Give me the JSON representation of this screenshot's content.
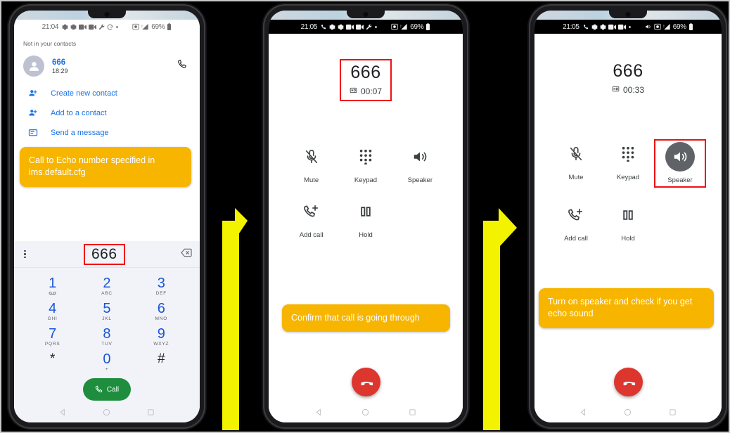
{
  "meta": {
    "accent_yellow": "#F7B500",
    "arrow_yellow": "#F3F300",
    "highlight_red": "#EE1111",
    "link_blue": "#1A73E8",
    "call_green": "#1E8E3E",
    "end_red": "#DC362E"
  },
  "phone1": {
    "statusbar": {
      "time": "21:04",
      "battery": "69%",
      "icons": [
        "gear-icon",
        "gear-icon",
        "video-icon",
        "video-icon",
        "wrench-icon",
        "google-g-icon",
        "dot-icon"
      ],
      "right_icons": [
        "screenshot-icon",
        "signal-icon",
        "battery-icon"
      ]
    },
    "not_in_contacts": "Not in your contacts",
    "contact": {
      "number": "666",
      "time": "18:29",
      "call_icon": "phone-icon",
      "avatar": "avatar-icon"
    },
    "actions": [
      {
        "label": "Create new contact",
        "icon": "add-person-icon"
      },
      {
        "label": "Add to a contact",
        "icon": "add-person-icon"
      },
      {
        "label": "Send a message",
        "icon": "message-icon"
      }
    ],
    "dialer": {
      "entered_number": "666",
      "menu_icon": "kebab-menu-icon",
      "backspace_icon": "backspace-icon",
      "keys": [
        {
          "digit": "1",
          "letters": ""
        },
        {
          "digit": "2",
          "letters": "ABC"
        },
        {
          "digit": "3",
          "letters": "DEF"
        },
        {
          "digit": "4",
          "letters": "GHI"
        },
        {
          "digit": "5",
          "letters": "JKL"
        },
        {
          "digit": "6",
          "letters": "MNO"
        },
        {
          "digit": "7",
          "letters": "PQRS"
        },
        {
          "digit": "8",
          "letters": "TUV"
        },
        {
          "digit": "9",
          "letters": "WXYZ"
        },
        {
          "digit": "*",
          "letters": ""
        },
        {
          "digit": "0",
          "letters": "+"
        },
        {
          "digit": "#",
          "letters": ""
        }
      ],
      "call_label": "Call"
    },
    "callout": "Call to Echo number specified in ims.default.cfg"
  },
  "phone2": {
    "statusbar": {
      "time": "21:05",
      "battery": "69%",
      "icons": [
        "phone-active-icon",
        "gear-icon",
        "gear-icon",
        "video-icon",
        "video-icon",
        "wrench-icon",
        "dot-icon"
      ],
      "right_icons": [
        "screenshot-icon",
        "signal-icon",
        "battery-icon"
      ]
    },
    "call": {
      "name": "666",
      "timer": "00:07",
      "hd_icon": "hd-call-icon"
    },
    "controls": [
      {
        "label": "Mute",
        "icon": "mic-off-icon",
        "active": false
      },
      {
        "label": "Keypad",
        "icon": "dialpad-icon",
        "active": false
      },
      {
        "label": "Speaker",
        "icon": "speaker-icon",
        "active": false
      },
      {
        "label": "Add call",
        "icon": "add-call-icon",
        "active": false
      },
      {
        "label": "Hold",
        "icon": "pause-icon",
        "active": false
      }
    ],
    "end_call_icon": "end-call-icon",
    "callout": "Confirm that call is going through"
  },
  "phone3": {
    "statusbar": {
      "time": "21:05",
      "battery": "69%",
      "icons": [
        "phone-active-icon",
        "gear-icon",
        "gear-icon",
        "video-icon",
        "video-icon",
        "dot-icon"
      ],
      "right_icons": [
        "speaker-on-icon",
        "screenshot-icon",
        "signal-icon",
        "battery-icon"
      ]
    },
    "call": {
      "name": "666",
      "timer": "00:33",
      "hd_icon": "hd-call-icon"
    },
    "controls": [
      {
        "label": "Mute",
        "icon": "mic-off-icon",
        "active": false
      },
      {
        "label": "Keypad",
        "icon": "dialpad-icon",
        "active": false
      },
      {
        "label": "Speaker",
        "icon": "speaker-icon",
        "active": true
      },
      {
        "label": "Add call",
        "icon": "add-call-icon",
        "active": false
      },
      {
        "label": "Hold",
        "icon": "pause-icon",
        "active": false
      }
    ],
    "end_call_icon": "end-call-icon",
    "callout": "Turn on speaker and check if you get echo sound"
  }
}
